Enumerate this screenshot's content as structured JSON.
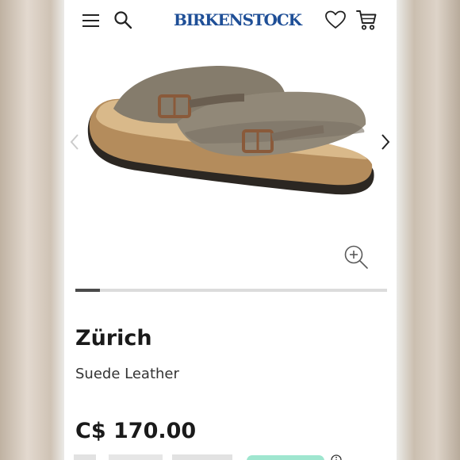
{
  "header": {
    "logo_text": "BIRKENSTOCK",
    "brand_color": "#1f4f97",
    "icons": [
      "menu-icon",
      "search-icon",
      "heart-icon",
      "cart-icon"
    ]
  },
  "gallery": {
    "image_subject": "Zürich suede sandal",
    "controls": [
      "prev-icon",
      "next-icon",
      "zoom-icon"
    ],
    "slider_progress": 0.08
  },
  "product": {
    "name": "Zürich",
    "material": "Suede Leather",
    "price": "C$ 170.00"
  }
}
